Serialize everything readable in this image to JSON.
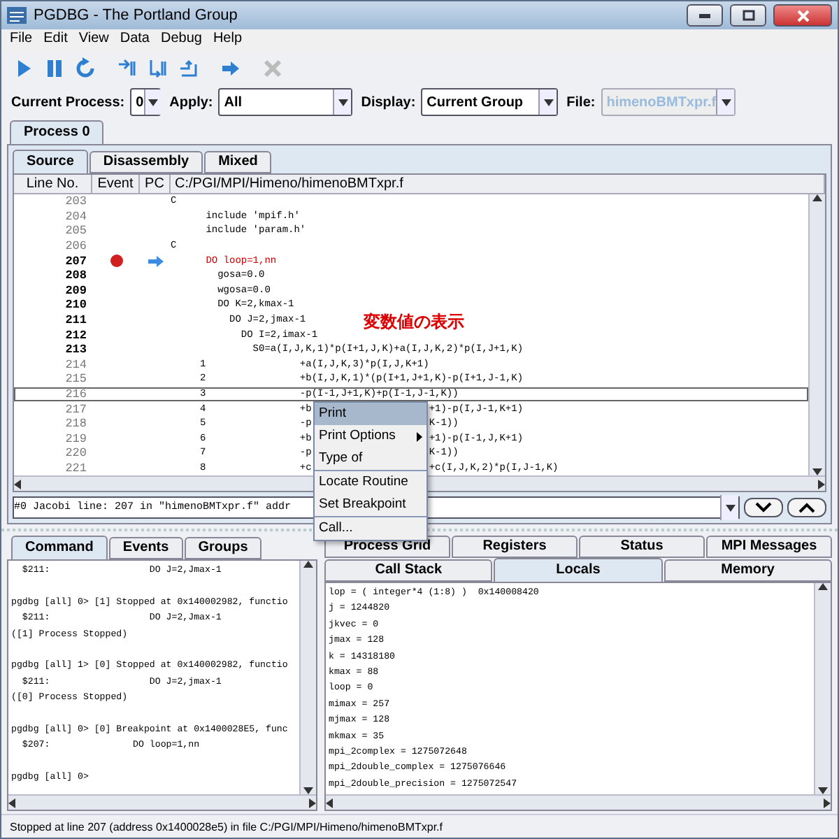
{
  "window": {
    "title": "PGDBG - The Portland Group"
  },
  "menu": [
    "File",
    "Edit",
    "View",
    "Data",
    "Debug",
    "Help"
  ],
  "toolbar": [
    {
      "kind": "play",
      "disabled": false
    },
    {
      "kind": "pause",
      "disabled": false
    },
    {
      "kind": "restart",
      "disabled": false
    },
    {
      "kind": "step-in",
      "disabled": false
    },
    {
      "kind": "step-over",
      "disabled": false
    },
    {
      "kind": "step-out",
      "disabled": false
    },
    {
      "kind": "arrow",
      "disabled": false
    },
    {
      "kind": "cross",
      "disabled": true
    }
  ],
  "selectors": [
    {
      "label": "Current Process:",
      "value": "0",
      "disabled": false
    },
    {
      "label": "Apply:",
      "value": "All",
      "disabled": false
    },
    {
      "label": "Display:",
      "value": "Current Group",
      "disabled": false
    },
    {
      "label": "File:",
      "value": "himenoBMTxpr.f",
      "disabled": true
    }
  ],
  "process_tabs": [
    {
      "label": "Process 0",
      "selected": true
    }
  ],
  "source_tabs": [
    {
      "label": "Source",
      "selected": true
    },
    {
      "label": "Disassembly",
      "selected": false
    },
    {
      "label": "Mixed",
      "selected": false
    }
  ],
  "source": {
    "columns": [
      "Line No.",
      "Event",
      "PC",
      "C:/PGI/MPI/Himeno/himenoBMTxpr.f"
    ],
    "rows": [
      {
        "line": "203",
        "code": "C",
        "executable": false,
        "breakpoint": false,
        "pc": false,
        "selected": false
      },
      {
        "line": "204",
        "code": "      include 'mpif.h'",
        "executable": false,
        "breakpoint": false,
        "pc": false,
        "selected": false
      },
      {
        "line": "205",
        "code": "      include 'param.h'",
        "executable": false,
        "breakpoint": false,
        "pc": false,
        "selected": false
      },
      {
        "line": "206",
        "code": "C",
        "executable": false,
        "breakpoint": false,
        "pc": false,
        "selected": false
      },
      {
        "line": "207",
        "code": "      DO loop=1,nn",
        "executable": true,
        "breakpoint": true,
        "pc": true,
        "selected": false
      },
      {
        "line": "208",
        "code": "        gosa=0.0",
        "executable": true,
        "breakpoint": false,
        "pc": false,
        "selected": false
      },
      {
        "line": "209",
        "code": "        wgosa=0.0",
        "executable": true,
        "breakpoint": false,
        "pc": false,
        "selected": false
      },
      {
        "line": "210",
        "code": "        DO K=2,kmax-1",
        "executable": true,
        "breakpoint": false,
        "pc": false,
        "selected": false
      },
      {
        "line": "211",
        "code": "          DO J=2,jmax-1",
        "executable": true,
        "breakpoint": false,
        "pc": false,
        "selected": false
      },
      {
        "line": "212",
        "code": "            DO I=2,imax-1",
        "executable": true,
        "breakpoint": false,
        "pc": false,
        "selected": false
      },
      {
        "line": "213",
        "code": "              S0=a(I,J,K,1)*p(I+1,J,K)+a(I,J,K,2)*p(I,J+1,K)",
        "executable": true,
        "breakpoint": false,
        "pc": false,
        "selected": false
      },
      {
        "line": "214",
        "code": "     1                +a(I,J,K,3)*p(I,J,K+1)",
        "executable": false,
        "breakpoint": false,
        "pc": false,
        "selected": false
      },
      {
        "line": "215",
        "code": "     2                +b(I,J,K,1)*(p(I+1,J+1,K)-p(I+1,J-1,K)",
        "executable": false,
        "breakpoint": false,
        "pc": false,
        "selected": false
      },
      {
        "line": "216",
        "code": "     3                -p(I-1,J+1,K)+p(I-1,J-1,K))",
        "executable": false,
        "breakpoint": false,
        "pc": false,
        "selected": true
      },
      {
        "line": "217",
        "code": "     4                +b",
        "code_after_menu": "+1)-p(I,J-1,K+1)",
        "executable": false,
        "breakpoint": false,
        "pc": false,
        "selected": false
      },
      {
        "line": "218",
        "code": "     5                -p",
        "code_after_menu": "K-1))",
        "executable": false,
        "breakpoint": false,
        "pc": false,
        "selected": false
      },
      {
        "line": "219",
        "code": "     6                +b",
        "code_after_menu": "+1)-p(I-1,J,K+1)",
        "executable": false,
        "breakpoint": false,
        "pc": false,
        "selected": false
      },
      {
        "line": "220",
        "code": "     7                -p",
        "code_after_menu": "K-1))",
        "executable": false,
        "breakpoint": false,
        "pc": false,
        "selected": false
      },
      {
        "line": "221",
        "code": "     8                +c",
        "code_after_menu": "+c(I,J,K,2)*p(I,J-1,K)",
        "executable": false,
        "breakpoint": false,
        "pc": false,
        "selected": false
      }
    ]
  },
  "annotation": "変数値の表示",
  "context_menu": [
    {
      "label": "Print",
      "selected": true,
      "submenu": false,
      "separator_before": false
    },
    {
      "label": "Print Options",
      "selected": false,
      "submenu": true,
      "separator_before": false
    },
    {
      "label": "Type of",
      "selected": false,
      "submenu": false,
      "separator_before": false
    },
    {
      "label": "Locate Routine",
      "selected": false,
      "submenu": false,
      "separator_before": true
    },
    {
      "label": "Set Breakpoint",
      "selected": false,
      "submenu": false,
      "separator_before": false
    },
    {
      "label": "Call...",
      "selected": false,
      "submenu": false,
      "separator_before": true
    }
  ],
  "frame_selector": {
    "value": "#0 Jacobi line: 207 in \"himenoBMTxpr.f\" addr"
  },
  "command_tabs": [
    {
      "label": "Command",
      "selected": true
    },
    {
      "label": "Events",
      "selected": false
    },
    {
      "label": "Groups",
      "selected": false
    }
  ],
  "console": [
    [
      "  $211:                  DO J=2,Jmax-1"
    ],
    [
      "pgdbg [all] 0> [1] Stopped at 0x140002982, functio",
      "  $211:                  DO J=2,Jmax-1",
      "([1] Process Stopped)"
    ],
    [
      "pgdbg [all] 1> [0] Stopped at 0x140002982, functio",
      "  $211:                  DO J=2,jmax-1",
      "([0] Process Stopped)"
    ],
    [
      "pgdbg [all] 0> [0] Breakpoint at 0x1400028E5, func",
      "  $207:               DO loop=1,nn"
    ],
    [
      "pgdbg [all] 0>"
    ]
  ],
  "info_tabs_back": [
    {
      "label": "Process Grid",
      "selected": false
    },
    {
      "label": "Registers",
      "selected": false
    },
    {
      "label": "Status",
      "selected": false
    },
    {
      "label": "MPI Messages",
      "selected": false
    }
  ],
  "info_tabs_front": [
    {
      "label": "Call Stack",
      "selected": false
    },
    {
      "label": "Locals",
      "selected": true
    },
    {
      "label": "Memory",
      "selected": false
    }
  ],
  "locals": [
    "lop = ( integer*4 (1:8) )  0x140008420",
    "j = 1244820",
    "jkvec = 0",
    "jmax = 128",
    "k = 14318180",
    "kmax = 88",
    "loop = 0",
    "mimax = 257",
    "mjmax = 128",
    "mkmax = 35",
    "mpi_2complex = 1275072648",
    "mpi_2double_complex = 1275076646",
    "mpi_2double_precision = 1275072547"
  ],
  "status_bar": "Stopped at line 207 (address 0x1400028e5) in file C:/PGI/MPI/Himeno/himenoBMTxpr.f"
}
